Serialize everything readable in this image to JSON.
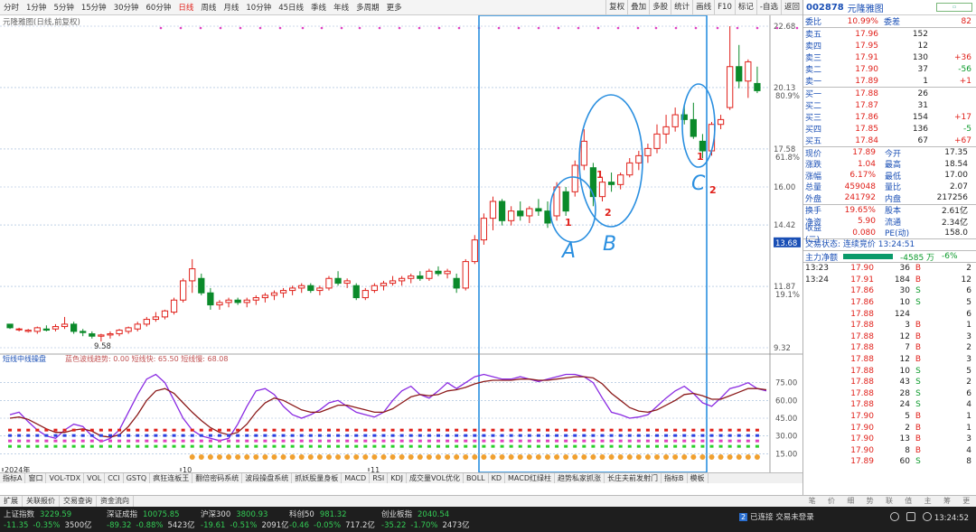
{
  "toolbar": {
    "periods": [
      "分时",
      "1分钟",
      "5分钟",
      "15分钟",
      "30分钟",
      "60分钟",
      "日线",
      "周线",
      "月线",
      "10分钟",
      "45日线",
      "季线",
      "年线",
      "多周期",
      "更多"
    ],
    "active_period": "日线",
    "right_buttons": [
      "复权",
      "叠加",
      "多股",
      "统计",
      "画线",
      "F10",
      "标记",
      "-自选",
      "返回"
    ]
  },
  "chart": {
    "title": "元隆雅图(日线,前复权)",
    "price_labels": [
      "22.68",
      "20.13",
      "17.58",
      "16.00",
      "14.42",
      "11.87",
      "9.32"
    ],
    "pct_labels": [
      "80.9%",
      "61.8%",
      "19.1%"
    ],
    "price_highlight": "13.68",
    "low_label": "9.58",
    "date_labels": [
      "2024年",
      "10",
      "11"
    ],
    "annotations": [
      "A",
      "B",
      "C"
    ],
    "indicator_title": "短线中线操盘",
    "indicator_values": "蓝色波线趋势: 0.00  短线快: 65.50  短线慢: 68.08",
    "indicator_axis": [
      "75.00",
      "60.00",
      "45.00",
      "30.00",
      "15.00"
    ]
  },
  "indicator_tabs": [
    "指标A",
    "窗口",
    "VOL-TDX",
    "VOL",
    "CCI",
    "GSTQ",
    "疯狂连板王",
    "翻倍密码系统",
    "波段操盘系统",
    "抓妖股量身板",
    "MACD",
    "RSI",
    "KDJ",
    "成交量VOL优化",
    "BOLL",
    "KD",
    "MACD红绿柱",
    "趋势私家抓涨",
    "长庄夫前发射门",
    "指标B",
    "模板"
  ],
  "strategy_tabs": [
    "扩展",
    "关联报价",
    "交易查询",
    "资金流向"
  ],
  "right_panel": {
    "code": "002878",
    "name": "元隆雅图",
    "weibi_label": "委比",
    "weibi_value": "10.99%",
    "weicha_label": "委差",
    "weicha_value": "82",
    "sells": [
      {
        "label": "卖五",
        "price": "17.96",
        "qty": "152",
        "chg": ""
      },
      {
        "label": "卖四",
        "price": "17.95",
        "qty": "12",
        "chg": ""
      },
      {
        "label": "卖三",
        "price": "17.91",
        "qty": "130",
        "chg": "+36"
      },
      {
        "label": "卖二",
        "price": "17.90",
        "qty": "37",
        "chg": "-56"
      },
      {
        "label": "卖一",
        "price": "17.89",
        "qty": "1",
        "chg": "+1"
      }
    ],
    "buys": [
      {
        "label": "买一",
        "price": "17.88",
        "qty": "26",
        "chg": ""
      },
      {
        "label": "买二",
        "price": "17.87",
        "qty": "31",
        "chg": ""
      },
      {
        "label": "买三",
        "price": "17.86",
        "qty": "154",
        "chg": "+17"
      },
      {
        "label": "买四",
        "price": "17.85",
        "qty": "136",
        "chg": "-5"
      },
      {
        "label": "买五",
        "price": "17.84",
        "qty": "67",
        "chg": "+67"
      }
    ],
    "stats": [
      {
        "k": "现价",
        "v": "17.89",
        "k2": "今开",
        "v2": "17.35"
      },
      {
        "k": "涨跌",
        "v": "1.04",
        "k2": "最高",
        "v2": "18.54"
      },
      {
        "k": "涨幅",
        "v": "6.17%",
        "k2": "最低",
        "v2": "17.00"
      },
      {
        "k": "总量",
        "v": "459048",
        "k2": "量比",
        "v2": "2.07"
      },
      {
        "k": "外盘",
        "v": "241792",
        "k2": "内盘",
        "v2": "217256"
      }
    ],
    "stats2": [
      {
        "k": "换手",
        "v": "19.65%",
        "k2": "股本",
        "v2": "2.61亿"
      },
      {
        "k": "净资",
        "v": "5.90",
        "k2": "流通",
        "v2": "2.34亿"
      },
      {
        "k": "收益(二)",
        "v": "0.080",
        "k2": "PE(动)",
        "v2": "158.0"
      }
    ],
    "status_label": "交易状态: 连续竞价 13:24:51",
    "zhuli_label": "主力净额",
    "zhuli_value": "-4585 万",
    "zhuli_pct": "-6%",
    "trades": [
      {
        "t": "13:23",
        "p": "17.90",
        "q": "36",
        "s": "B",
        "n": "2"
      },
      {
        "t": "13:24",
        "p": "17.91",
        "q": "184",
        "s": "B",
        "n": "12"
      },
      {
        "t": "",
        "p": "17.86",
        "q": "30",
        "s": "S",
        "n": "6"
      },
      {
        "t": "",
        "p": "17.86",
        "q": "10",
        "s": "S",
        "n": "5"
      },
      {
        "t": "",
        "p": "17.88",
        "q": "124",
        "s": "",
        "n": "6"
      },
      {
        "t": "",
        "p": "17.88",
        "q": "3",
        "s": "B",
        "n": "1"
      },
      {
        "t": "",
        "p": "17.88",
        "q": "12",
        "s": "B",
        "n": "3"
      },
      {
        "t": "",
        "p": "17.88",
        "q": "7",
        "s": "B",
        "n": "2"
      },
      {
        "t": "",
        "p": "17.88",
        "q": "12",
        "s": "B",
        "n": "3"
      },
      {
        "t": "",
        "p": "17.88",
        "q": "10",
        "s": "S",
        "n": "5"
      },
      {
        "t": "",
        "p": "17.88",
        "q": "43",
        "s": "S",
        "n": "2"
      },
      {
        "t": "",
        "p": "17.88",
        "q": "28",
        "s": "S",
        "n": "6"
      },
      {
        "t": "",
        "p": "17.88",
        "q": "24",
        "s": "S",
        "n": "4"
      },
      {
        "t": "",
        "p": "17.90",
        "q": "5",
        "s": "B",
        "n": "1"
      },
      {
        "t": "",
        "p": "17.90",
        "q": "2",
        "s": "B",
        "n": "1"
      },
      {
        "t": "",
        "p": "17.90",
        "q": "13",
        "s": "B",
        "n": "3"
      },
      {
        "t": "",
        "p": "17.90",
        "q": "8",
        "s": "B",
        "n": "4"
      },
      {
        "t": "",
        "p": "17.89",
        "q": "60",
        "s": "S",
        "n": "8"
      }
    ],
    "tabs": [
      "笔",
      "价",
      "细",
      "势",
      "联",
      "值",
      "主",
      "筹",
      "更"
    ]
  },
  "indices": [
    {
      "name": "上证指数",
      "val": "3229.59",
      "chg": "-11.35",
      "pct": "-0.35%",
      "amt": "3500亿"
    },
    {
      "name": "深证成指",
      "val": "10075.85",
      "chg": "-89.32",
      "pct": "-0.88%",
      "amt": "5423亿"
    },
    {
      "name": "沪深300",
      "val": "3800.93",
      "chg": "-19.61",
      "pct": "-0.51%",
      "amt": "2091亿"
    },
    {
      "name": "科创50",
      "val": "981.32",
      "chg": "-0.46",
      "pct": "-0.05%",
      "amt": "717.2亿"
    },
    {
      "name": "创业板指",
      "val": "2040.54",
      "chg": "-35.22",
      "pct": "-1.70%",
      "amt": "2473亿"
    }
  ],
  "connection": {
    "badge": "2",
    "text": "已连接 交易未登录"
  },
  "clock": "13:24:52",
  "chart_data": {
    "type": "candlestick",
    "ylim": [
      9.32,
      22.68
    ],
    "candles": [
      [
        10.3,
        10.3,
        10.1,
        10.15
      ],
      [
        10.1,
        10.15,
        10.0,
        10.1
      ],
      [
        10.0,
        10.1,
        9.95,
        10.05
      ],
      [
        10.0,
        10.2,
        9.9,
        10.15
      ],
      [
        10.1,
        10.25,
        10.0,
        10.05
      ],
      [
        10.1,
        10.3,
        10.0,
        10.2
      ],
      [
        10.2,
        10.6,
        10.1,
        10.3
      ],
      [
        10.3,
        10.4,
        9.9,
        10.0
      ],
      [
        10.0,
        10.1,
        9.8,
        9.95
      ],
      [
        9.9,
        10.0,
        9.7,
        9.8
      ],
      [
        9.8,
        9.9,
        9.58,
        9.85
      ],
      [
        9.85,
        10.0,
        9.7,
        9.9
      ],
      [
        9.9,
        10.1,
        9.8,
        10.05
      ],
      [
        10.0,
        10.2,
        9.9,
        10.15
      ],
      [
        10.1,
        10.4,
        10.0,
        10.3
      ],
      [
        10.3,
        10.6,
        10.2,
        10.5
      ],
      [
        10.5,
        10.8,
        10.4,
        10.6
      ],
      [
        10.6,
        10.9,
        10.5,
        10.85
      ],
      [
        10.8,
        11.4,
        10.7,
        11.3
      ],
      [
        11.3,
        12.2,
        11.2,
        12.1
      ],
      [
        12.1,
        13.0,
        11.6,
        12.6
      ],
      [
        12.2,
        12.4,
        11.5,
        11.6
      ],
      [
        11.6,
        11.8,
        10.9,
        11.1
      ],
      [
        11.1,
        11.3,
        10.9,
        11.2
      ],
      [
        11.2,
        11.4,
        11.0,
        11.3
      ],
      [
        11.3,
        11.4,
        11.1,
        11.2
      ],
      [
        11.2,
        11.4,
        11.0,
        11.3
      ],
      [
        11.3,
        11.5,
        11.1,
        11.4
      ],
      [
        11.4,
        11.6,
        11.2,
        11.5
      ],
      [
        11.5,
        11.7,
        11.3,
        11.6
      ],
      [
        11.6,
        11.8,
        11.4,
        11.7
      ],
      [
        11.7,
        11.9,
        11.5,
        11.8
      ],
      [
        11.8,
        12.0,
        11.6,
        11.9
      ],
      [
        11.9,
        12.0,
        11.6,
        11.7
      ],
      [
        11.7,
        11.9,
        11.5,
        11.8
      ],
      [
        11.8,
        12.3,
        11.7,
        12.2
      ],
      [
        12.2,
        12.5,
        11.9,
        12.0
      ],
      [
        12.0,
        12.2,
        11.8,
        12.1
      ],
      [
        11.9,
        12.0,
        11.3,
        11.4
      ],
      [
        11.4,
        11.8,
        11.3,
        11.7
      ],
      [
        11.7,
        12.0,
        11.6,
        11.9
      ],
      [
        11.9,
        12.1,
        11.7,
        12.0
      ],
      [
        12.0,
        12.3,
        11.9,
        12.1
      ],
      [
        12.1,
        12.3,
        11.9,
        12.2
      ],
      [
        12.2,
        12.4,
        12.0,
        12.3
      ],
      [
        12.3,
        12.5,
        12.1,
        12.2
      ],
      [
        12.2,
        12.6,
        12.1,
        12.5
      ],
      [
        12.5,
        12.7,
        12.3,
        12.4
      ],
      [
        12.4,
        12.6,
        12.2,
        12.5
      ],
      [
        12.2,
        12.4,
        11.6,
        11.8
      ],
      [
        11.8,
        13.0,
        11.7,
        12.9
      ],
      [
        12.9,
        14.0,
        12.8,
        13.8
      ],
      [
        13.8,
        14.9,
        13.6,
        14.7
      ],
      [
        14.7,
        15.6,
        14.2,
        15.4
      ],
      [
        15.4,
        15.5,
        14.4,
        14.6
      ],
      [
        14.6,
        15.2,
        14.4,
        15.0
      ],
      [
        15.0,
        15.4,
        14.6,
        14.8
      ],
      [
        14.8,
        15.2,
        14.5,
        15.1
      ],
      [
        15.1,
        15.5,
        14.8,
        15.0
      ],
      [
        15.0,
        15.4,
        14.3,
        14.5
      ],
      [
        14.8,
        16.2,
        14.6,
        16.0
      ],
      [
        15.8,
        16.0,
        14.8,
        15.0
      ],
      [
        15.8,
        17.1,
        15.6,
        16.9
      ],
      [
        16.9,
        18.4,
        16.7,
        17.9
      ],
      [
        16.8,
        17.0,
        15.2,
        15.6
      ],
      [
        15.6,
        16.4,
        15.4,
        16.2
      ],
      [
        16.2,
        16.6,
        15.8,
        16.1
      ],
      [
        16.1,
        16.6,
        15.9,
        16.5
      ],
      [
        16.5,
        17.2,
        16.4,
        17.0
      ],
      [
        17.0,
        17.5,
        16.7,
        17.3
      ],
      [
        17.3,
        17.8,
        17.0,
        17.6
      ],
      [
        17.6,
        18.6,
        17.4,
        18.2
      ],
      [
        18.2,
        19.0,
        17.8,
        18.5
      ],
      [
        18.5,
        19.3,
        18.3,
        19.0
      ],
      [
        19.0,
        19.4,
        18.6,
        18.8
      ],
      [
        18.8,
        19.5,
        18.0,
        18.1
      ],
      [
        17.9,
        18.2,
        17.2,
        17.5
      ],
      [
        17.5,
        18.7,
        17.3,
        18.6
      ],
      [
        18.6,
        19.0,
        18.4,
        18.8
      ],
      [
        19.3,
        22.68,
        19.2,
        21.0
      ],
      [
        21.0,
        21.9,
        20.1,
        20.4
      ],
      [
        20.4,
        21.3,
        19.7,
        21.2
      ],
      [
        20.3,
        21.0,
        19.9,
        20.0
      ]
    ]
  }
}
